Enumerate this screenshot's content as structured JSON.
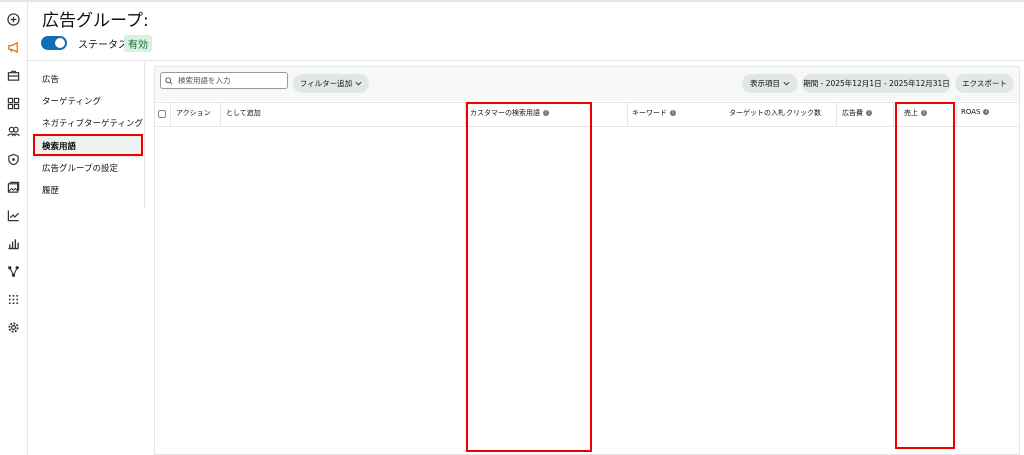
{
  "header": {
    "title": "広告グループ:",
    "status_label": "ステータス:",
    "status_value": "有効"
  },
  "rail": {
    "icons": [
      "plus-circle-icon",
      "megaphone-icon",
      "briefcase-icon",
      "grid-icon",
      "users-icon",
      "shield-icon",
      "images-icon",
      "line-chart-icon",
      "bar-chart-icon",
      "network-icon",
      "apps-dots-icon",
      "gear-icon"
    ]
  },
  "subnav": {
    "items": [
      {
        "label": "広告"
      },
      {
        "label": "ターゲティング"
      },
      {
        "label": "ネガティブターゲティング"
      },
      {
        "label": "検索用語"
      },
      {
        "label": "広告グループの設定"
      },
      {
        "label": "履歴"
      }
    ]
  },
  "toolbar": {
    "search_placeholder": "検索用語を入力",
    "filter_label": "フィルター追加",
    "columns_label": "表示項目",
    "period_label": "期間 - 2025年12月1日 - 2025年12月31日",
    "export_label": "エクスポート"
  },
  "table": {
    "columns": [
      "アクション",
      "として追加",
      "カスタマーの検索用語",
      "キーワード",
      "ターゲットの入札",
      "クリック数",
      "広告費",
      "売上",
      "ROAS"
    ]
  },
  "colors": {
    "accent": "#146eb4",
    "annotation": "#e00000",
    "badge_bg": "#d9f2e0"
  }
}
